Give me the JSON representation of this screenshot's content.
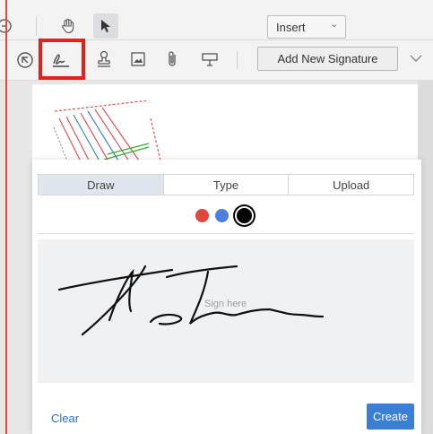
{
  "toolbar": {
    "insert_select": {
      "selected": "Insert"
    },
    "add_signature_label": "Add New Signature"
  },
  "modal": {
    "tabs": [
      {
        "label": "Draw",
        "active": true
      },
      {
        "label": "Type",
        "active": false
      },
      {
        "label": "Upload",
        "active": false
      }
    ],
    "colors": [
      {
        "name": "red",
        "hex": "#e0463a",
        "selected": false
      },
      {
        "name": "blue",
        "hex": "#4a7fe0",
        "selected": false
      },
      {
        "name": "black",
        "hex": "#000000",
        "selected": true
      }
    ],
    "canvas_placeholder": "Sign here",
    "clear_label": "Clear",
    "create_label": "Create"
  },
  "colors": {
    "accent": "#3a7fd4",
    "highlight": "#e8201b"
  }
}
